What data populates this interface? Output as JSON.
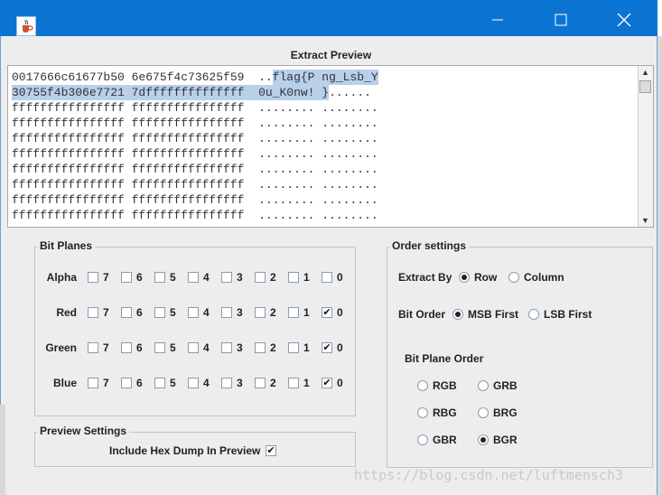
{
  "window": {
    "icon": "java-cup-icon",
    "minimize": "—",
    "maximize": "☐",
    "close": "✕"
  },
  "preview": {
    "title": "Extract Preview",
    "rows": [
      {
        "hex": "0017666c61677b50 6e675f4c73625f59",
        "ascii_a": "..",
        "ascii_b": "flag{P ng_Lsb_Y",
        "ascii_c": ""
      },
      {
        "hex": "30755f4b306e7721 7dffffffffffffff",
        "ascii_a": "",
        "ascii_b": "0u_K0nw! }",
        "ascii_c": "......"
      },
      {
        "hex": "ffffffffffffffff ffffffffffffffff",
        "ascii_a": "",
        "ascii_b": "",
        "ascii_c": "........ ........"
      },
      {
        "hex": "ffffffffffffffff ffffffffffffffff",
        "ascii_a": "",
        "ascii_b": "",
        "ascii_c": "........ ........"
      },
      {
        "hex": "ffffffffffffffff ffffffffffffffff",
        "ascii_a": "",
        "ascii_b": "",
        "ascii_c": "........ ........"
      },
      {
        "hex": "ffffffffffffffff ffffffffffffffff",
        "ascii_a": "",
        "ascii_b": "",
        "ascii_c": "........ ........"
      },
      {
        "hex": "ffffffffffffffff ffffffffffffffff",
        "ascii_a": "",
        "ascii_b": "",
        "ascii_c": "........ ........"
      },
      {
        "hex": "ffffffffffffffff ffffffffffffffff",
        "ascii_a": "",
        "ascii_b": "",
        "ascii_c": "........ ........"
      },
      {
        "hex": "ffffffffffffffff ffffffffffffffff",
        "ascii_a": "",
        "ascii_b": "",
        "ascii_c": "........ ........"
      },
      {
        "hex": "ffffffffffffffff ffffffffffffffff",
        "ascii_a": "",
        "ascii_b": "",
        "ascii_c": "........ ........"
      }
    ]
  },
  "bit_planes": {
    "title": "Bit Planes",
    "bits": [
      "7",
      "6",
      "5",
      "4",
      "3",
      "2",
      "1",
      "0"
    ],
    "channels": [
      {
        "name": "Alpha",
        "checked": [
          false,
          false,
          false,
          false,
          false,
          false,
          false,
          false
        ]
      },
      {
        "name": "Red",
        "checked": [
          false,
          false,
          false,
          false,
          false,
          false,
          false,
          true
        ]
      },
      {
        "name": "Green",
        "checked": [
          false,
          false,
          false,
          false,
          false,
          false,
          false,
          true
        ]
      },
      {
        "name": "Blue",
        "checked": [
          false,
          false,
          false,
          false,
          false,
          false,
          false,
          true
        ]
      }
    ]
  },
  "preview_settings": {
    "title": "Preview Settings",
    "hex_dump_label": "Include Hex Dump In Preview",
    "hex_dump_checked": true
  },
  "order_settings": {
    "title": "Order settings",
    "extract_by_label": "Extract By",
    "extract_by_options": [
      {
        "label": "Row",
        "selected": true
      },
      {
        "label": "Column",
        "selected": false
      }
    ],
    "bit_order_label": "Bit Order",
    "bit_order_options": [
      {
        "label": "MSB First",
        "selected": true
      },
      {
        "label": "LSB First",
        "selected": false
      }
    ],
    "plane_order_label": "Bit Plane Order",
    "plane_order_options": [
      {
        "label": "RGB",
        "selected": false
      },
      {
        "label": "GRB",
        "selected": false
      },
      {
        "label": "RBG",
        "selected": false
      },
      {
        "label": "BRG",
        "selected": false
      },
      {
        "label": "GBR",
        "selected": false
      },
      {
        "label": "BGR",
        "selected": true
      }
    ]
  },
  "check_mark": "✔",
  "watermark": "https://blog.csdn.net/luftmensch3"
}
